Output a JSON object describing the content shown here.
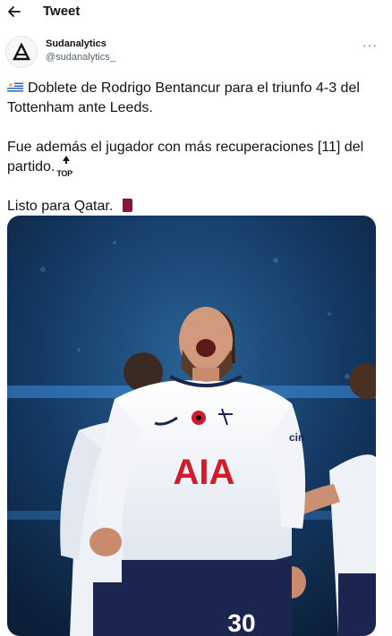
{
  "header": {
    "title": "Tweet",
    "back_icon": "back-arrow-icon"
  },
  "tweet": {
    "author_name": "Sudanalytics",
    "author_handle": "@sudanalytics_",
    "more_label": "···",
    "line1": "Doblete de Rodrigo Bentancur para el triunfo 4-3 del Tottenham ante Leeds.",
    "line2": "Fue además el jugador con más recuperaciones [11] del partido.",
    "line3": "Listo para Qatar.",
    "emoji_top_label": "TOP",
    "emojis": [
      "uruguay-flag-icon",
      "top-arrow-icon",
      "qatar-flag-icon"
    ]
  },
  "photo": {
    "sponsor": "AIA",
    "shirt_number": "30",
    "sleeve_text": "cin",
    "colors": {
      "shirt": "#f2f4f8",
      "navy": "#1b2650",
      "red": "#d11a2a",
      "stadium_blue": "#1f4d87"
    }
  }
}
